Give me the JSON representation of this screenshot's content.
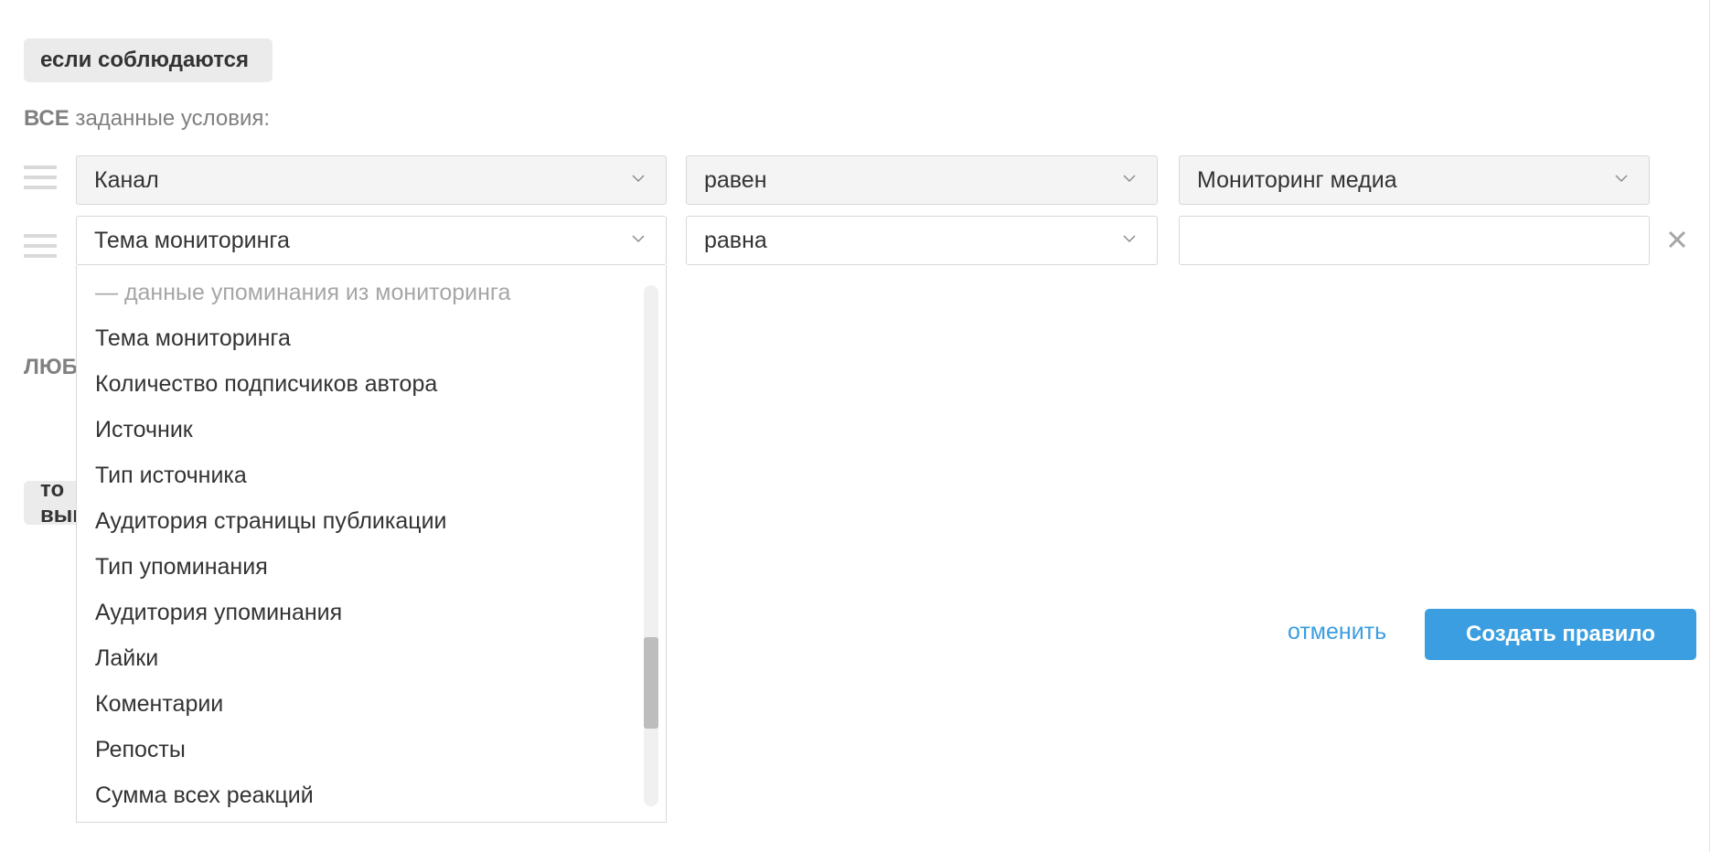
{
  "rule": {
    "if_pill": "если соблюдаются",
    "all_label_strong": "ВСЕ",
    "all_label_rest": " заданные условия:",
    "any_label": "ЛЮБЫЕ",
    "then_pill": "то выполнить"
  },
  "conditions": [
    {
      "field": "Канал",
      "operator": "равен",
      "value": "Мониторинг медиа"
    },
    {
      "field": "Тема мониторинга",
      "operator": "равна",
      "value": ""
    }
  ],
  "dropdown": {
    "group_label": "— данные упоминания из мониторинга",
    "items": [
      "Тема мониторинга",
      "Количество подписчиков автора",
      "Источник",
      "Тип источника",
      "Аудитория страницы публикации",
      "Тип упоминания",
      "Аудитория упоминания",
      "Лайки",
      "Коментарии",
      "Репосты",
      "Сумма всех реакций"
    ],
    "scroll_position": 0.82
  },
  "actions": {
    "cancel_label": "отменить",
    "create_label": "Создать правило"
  },
  "colors": {
    "accent": "#3a9ee0",
    "pill_bg": "#ebebeb",
    "muted_text": "#808080"
  },
  "icons": {
    "drag_handle": "drag-handle-icon",
    "chevron": "chevron-down-icon",
    "remove": "close-icon"
  }
}
